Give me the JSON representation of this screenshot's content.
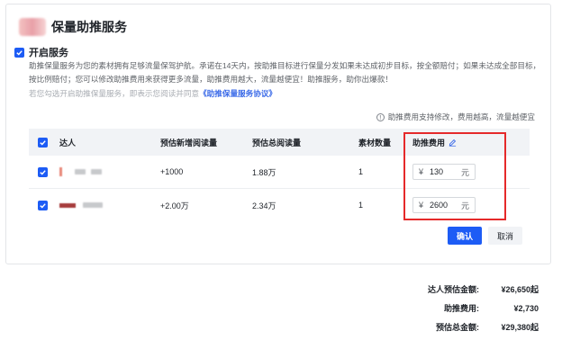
{
  "header": {
    "title": "保量助推服务"
  },
  "enable": {
    "label": "开启服务",
    "checked": true
  },
  "description": "助推保量服务为您的素材拥有足够流量保驾护航。承诺在14天内，按助推目标进行保量分发如果未达成初步目标，按全额赔付；如果未达成全部目标，按比例赔付；您可以修改助推费用来获得更多流量，助推费用越大，流量越便宜！助推服务，助你出爆款！",
  "agreement": {
    "prefix": "若您勾选开启助推保量服务，即表示您阅读并同意",
    "link": "《助推保量服务协议》"
  },
  "hint": {
    "icon": "info-icon",
    "text": "助推费用支持修改，费用越高，流量越便宜"
  },
  "table": {
    "headers": [
      "达人",
      "预估新增阅读量",
      "预估总阅读量",
      "素材数量",
      "助推费用"
    ],
    "rows": [
      {
        "checked": true,
        "new_reads": "+1000",
        "total_reads": "1.88万",
        "count": "1",
        "fee_currency": "¥",
        "fee": "130",
        "fee_unit": "元"
      },
      {
        "checked": true,
        "new_reads": "+2.00万",
        "total_reads": "2.34万",
        "count": "1",
        "fee_currency": "¥",
        "fee": "2600",
        "fee_unit": "元"
      }
    ]
  },
  "buttons": {
    "confirm": "确认",
    "cancel": "取消"
  },
  "summary": [
    {
      "label": "达人预估金额:",
      "value": "¥26,650起"
    },
    {
      "label": "助推费用:",
      "value": "¥2,730"
    },
    {
      "label": "预估总金额:",
      "value": "¥29,380起"
    }
  ],
  "colors": {
    "primary": "#1d5cf5",
    "highlight_box": "#e5292a"
  }
}
